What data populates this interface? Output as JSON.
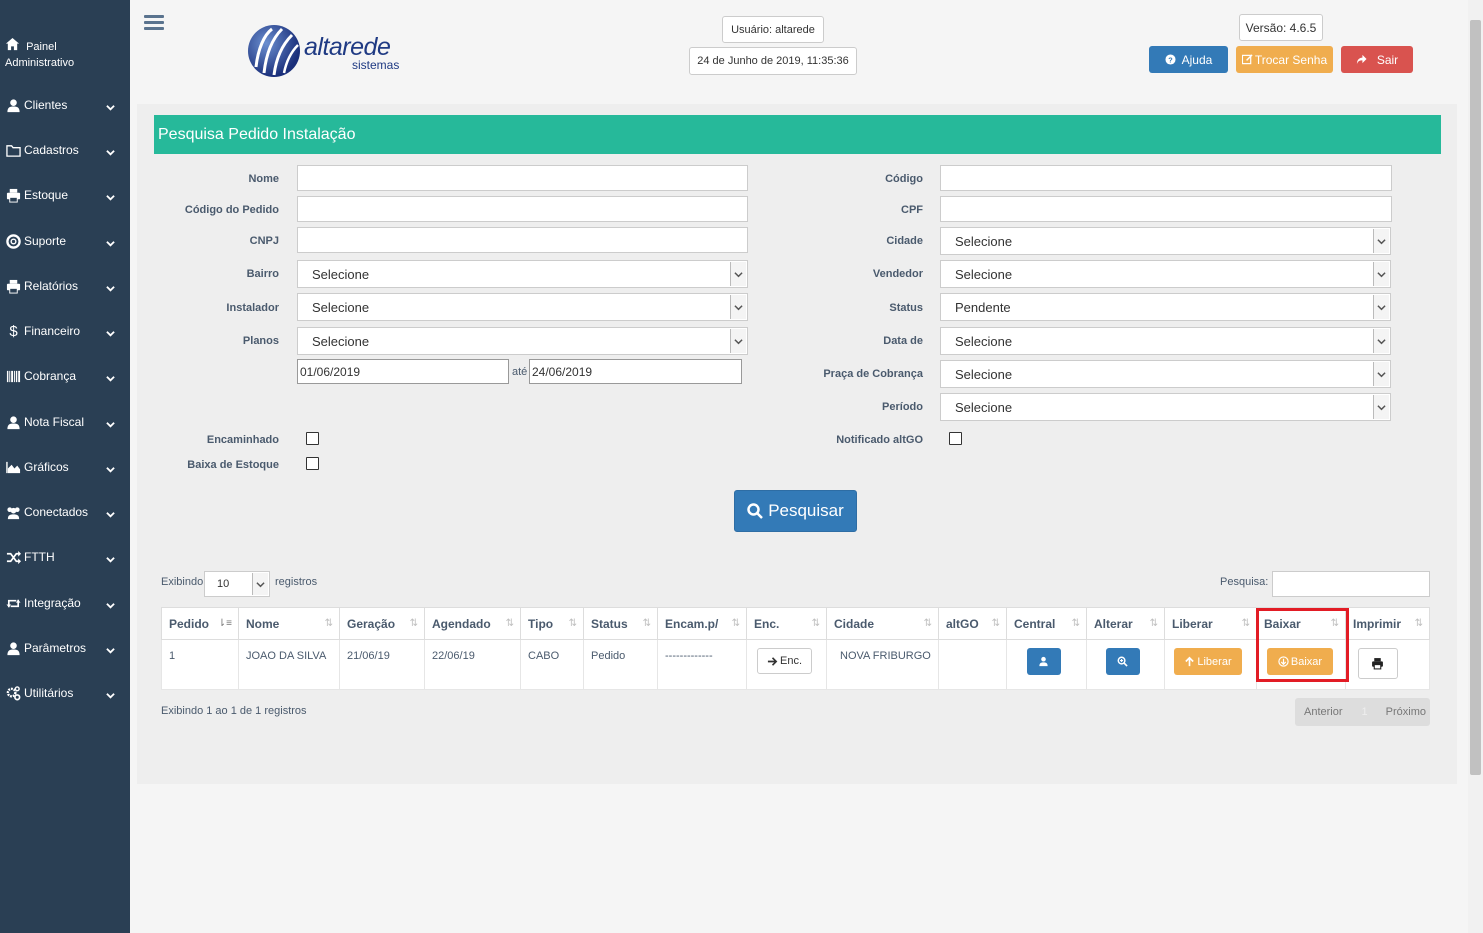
{
  "sidebar": {
    "home_line1": "Painel",
    "home_line2": "Administrativo",
    "items": [
      {
        "label": "Clientes",
        "icon": "user-icon"
      },
      {
        "label": "Cadastros",
        "icon": "folder-icon"
      },
      {
        "label": "Estoque",
        "icon": "printer-icon"
      },
      {
        "label": "Suporte",
        "icon": "lifebuoy-icon"
      },
      {
        "label": "Relatórios",
        "icon": "printer-icon"
      },
      {
        "label": "Financeiro",
        "icon": "dollar-icon"
      },
      {
        "label": "Cobrança",
        "icon": "barcode-icon"
      },
      {
        "label": "Nota Fiscal",
        "icon": "user-icon"
      },
      {
        "label": "Gráficos",
        "icon": "area-chart-icon"
      },
      {
        "label": "Conectados",
        "icon": "users-icon"
      },
      {
        "label": "FTTH",
        "icon": "random-icon"
      },
      {
        "label": "Integração",
        "icon": "retweet-icon"
      },
      {
        "label": "Parâmetros",
        "icon": "user-icon"
      },
      {
        "label": "Utilitários",
        "icon": "cogs-icon"
      }
    ]
  },
  "header": {
    "logo_main": "altarede",
    "logo_sub": "sistemas",
    "user": "Usuário: altarede",
    "datetime": "24 de Junho de 2019, 11:35:36",
    "version": "Versão: 4.6.5",
    "help_label": "Ajuda",
    "change_password_label": "Trocar Senha",
    "logout_label": "Sair"
  },
  "form": {
    "title": "Pesquisa Pedido Instalação",
    "left": {
      "nome_label": "Nome",
      "nome_value": "",
      "codigo_pedido_label": "Código do Pedido",
      "codigo_pedido_value": "",
      "cnpj_label": "CNPJ",
      "cnpj_value": "",
      "bairro_label": "Bairro",
      "bairro_value": "Selecione",
      "instalador_label": "Instalador",
      "instalador_value": "Selecione",
      "planos_label": "Planos",
      "planos_value": "Selecione",
      "date_from": "01/06/2019",
      "date_sep": "até",
      "date_to": "24/06/2019",
      "encaminhado_label": "Encaminhado",
      "baixa_estoque_label": "Baixa de Estoque"
    },
    "right": {
      "codigo_label": "Código",
      "codigo_value": "",
      "cpf_label": "CPF",
      "cpf_value": "",
      "cidade_label": "Cidade",
      "cidade_value": "Selecione",
      "vendedor_label": "Vendedor",
      "vendedor_value": "Selecione",
      "status_label": "Status",
      "status_value": "Pendente",
      "data_de_label": "Data de",
      "data_de_value": "Selecione",
      "praca_label": "Praça de Cobrança",
      "praca_value": "Selecione",
      "periodo_label": "Período",
      "periodo_value": "Selecione",
      "notificado_label": "Notificado altGO"
    },
    "search_button": "Pesquisar"
  },
  "table": {
    "showing_prefix": "Exibindo",
    "page_size": "10",
    "showing_suffix": "registros",
    "search_label": "Pesquisa:",
    "search_value": "",
    "columns": [
      "Pedido",
      "Nome",
      "Geração",
      "Agendado",
      "Tipo",
      "Status",
      "Encam.p/",
      "Enc.",
      "Cidade",
      "altGO",
      "Central",
      "Alterar",
      "Liberar",
      "Baixar",
      "Imprimir"
    ],
    "rows": [
      {
        "pedido": "1",
        "nome": "JOAO DA SILVA",
        "geracao": "21/06/19",
        "agendado": "22/06/19",
        "tipo": "CABO",
        "status": "Pedido",
        "encam": "-------------",
        "enc_button": "Enc.",
        "cidade": "NOVA FRIBURGO",
        "altgo": "",
        "liberar_button": "Liberar",
        "baixar_button": "Baixar"
      }
    ],
    "footer_info": "Exibindo 1 ao 1 de 1 registros",
    "prev": "Anterior",
    "page": "1",
    "next": "Próximo"
  },
  "colors": {
    "sidebar": "#2a3f54",
    "title_bar": "#26b99a",
    "primary": "#337ab7",
    "warning": "#f0ad4e",
    "danger": "#d9534f",
    "highlight": "#e21c25"
  }
}
